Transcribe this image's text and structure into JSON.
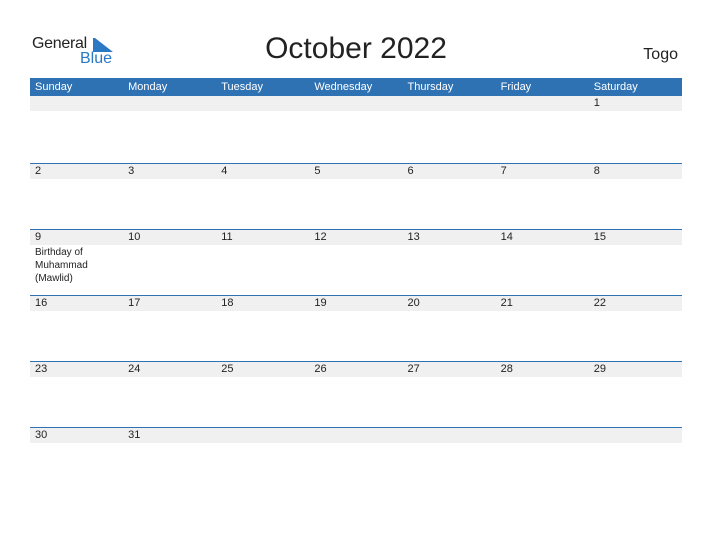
{
  "logo": {
    "word1": "General",
    "word2": "Blue"
  },
  "title": "October 2022",
  "country": "Togo",
  "weekdays": [
    "Sunday",
    "Monday",
    "Tuesday",
    "Wednesday",
    "Thursday",
    "Friday",
    "Saturday"
  ],
  "weeks": [
    {
      "days": [
        "",
        "",
        "",
        "",
        "",
        "",
        "1"
      ],
      "events": [
        "",
        "",
        "",
        "",
        "",
        "",
        ""
      ]
    },
    {
      "days": [
        "2",
        "3",
        "4",
        "5",
        "6",
        "7",
        "8"
      ],
      "events": [
        "",
        "",
        "",
        "",
        "",
        "",
        ""
      ]
    },
    {
      "days": [
        "9",
        "10",
        "11",
        "12",
        "13",
        "14",
        "15"
      ],
      "events": [
        "Birthday of Muhammad (Mawlid)",
        "",
        "",
        "",
        "",
        "",
        ""
      ]
    },
    {
      "days": [
        "16",
        "17",
        "18",
        "19",
        "20",
        "21",
        "22"
      ],
      "events": [
        "",
        "",
        "",
        "",
        "",
        "",
        ""
      ]
    },
    {
      "days": [
        "23",
        "24",
        "25",
        "26",
        "27",
        "28",
        "29"
      ],
      "events": [
        "",
        "",
        "",
        "",
        "",
        "",
        ""
      ]
    },
    {
      "days": [
        "30",
        "31",
        "",
        "",
        "",
        "",
        ""
      ],
      "events": [
        "",
        "",
        "",
        "",
        "",
        "",
        ""
      ]
    }
  ],
  "colors": {
    "accent": "#2f72b3",
    "day_bar": "#f0f0f0",
    "logo_blue": "#2b79c2"
  }
}
